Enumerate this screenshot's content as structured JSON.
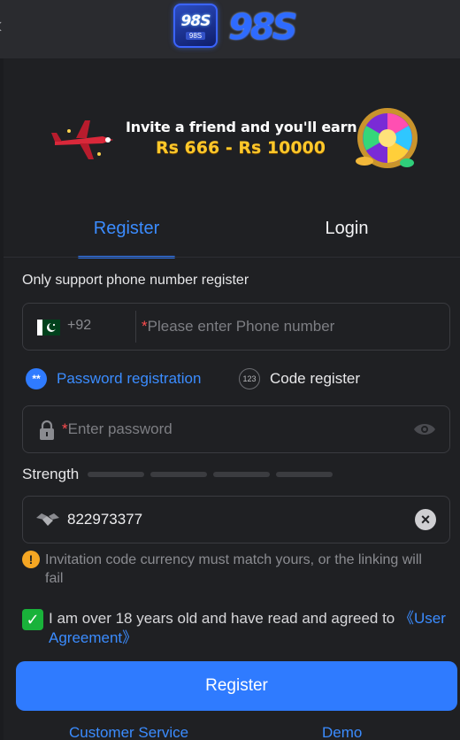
{
  "header": {
    "logo_badge_text": "98S",
    "logo_badge_sub": "98S",
    "logo_text": "98S"
  },
  "banner": {
    "line1": "Invite a friend and you'll earn",
    "line2": "Rs 666 - Rs 10000"
  },
  "tabs": [
    {
      "label": "Register",
      "active": true
    },
    {
      "label": "Login",
      "active": false
    }
  ],
  "form": {
    "support_note": "Only support phone number register",
    "country_code": "+92",
    "phone_placeholder": "Please enter Phone number",
    "modes": [
      {
        "label": "Password registration",
        "icon": "**",
        "selected": true
      },
      {
        "label": "Code register",
        "icon": "123",
        "selected": false
      }
    ],
    "password_placeholder": "Enter password",
    "strength_label": "Strength",
    "invite_code": "822973377",
    "invite_warning": "Invitation code currency must match yours, or the linking will fail",
    "agree_text": "I am over 18 years old and have read and agreed to ",
    "agree_link": "《User Agreement》",
    "agree_checked": true,
    "submit_label": "Register"
  },
  "footer": {
    "customer_service": "Customer Service",
    "demo": "Demo"
  },
  "colors": {
    "accent": "#2f7bff",
    "background": "#1f2023",
    "required": "#ff4d4f",
    "warning": "#f5a623",
    "check": "#19b23a"
  }
}
